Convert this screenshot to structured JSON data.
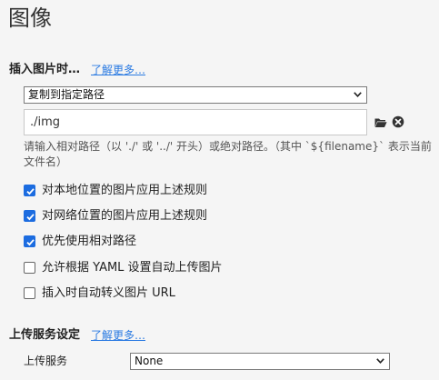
{
  "page": {
    "title": "图像"
  },
  "insert_section": {
    "title": "插入图片时…",
    "learn_more": "了解更多…",
    "action_select": {
      "value": "复制到指定路径"
    },
    "path_input": {
      "value": "./img"
    },
    "folder_icon": "folder-icon",
    "clear_icon": "clear-circle-icon",
    "hint": "请输入相对路径（以 './' 或 '../' 开头）或绝对路径。（其中 `${filename}` 表示当前文件名）",
    "options": [
      {
        "label": "对本地位置的图片应用上述规则",
        "checked": true
      },
      {
        "label": "对网络位置的图片应用上述规则",
        "checked": true
      },
      {
        "label": "优先使用相对路径",
        "checked": true
      },
      {
        "label": "允许根据 YAML 设置自动上传图片",
        "checked": false
      },
      {
        "label": "插入时自动转义图片 URL",
        "checked": false
      }
    ]
  },
  "upload_section": {
    "title": "上传服务设定",
    "learn_more": "了解更多…",
    "service_label": "上传服务",
    "service_select": {
      "value": "None"
    }
  },
  "colors": {
    "accent": "#1c6ce0",
    "link": "#2a7ae2"
  }
}
